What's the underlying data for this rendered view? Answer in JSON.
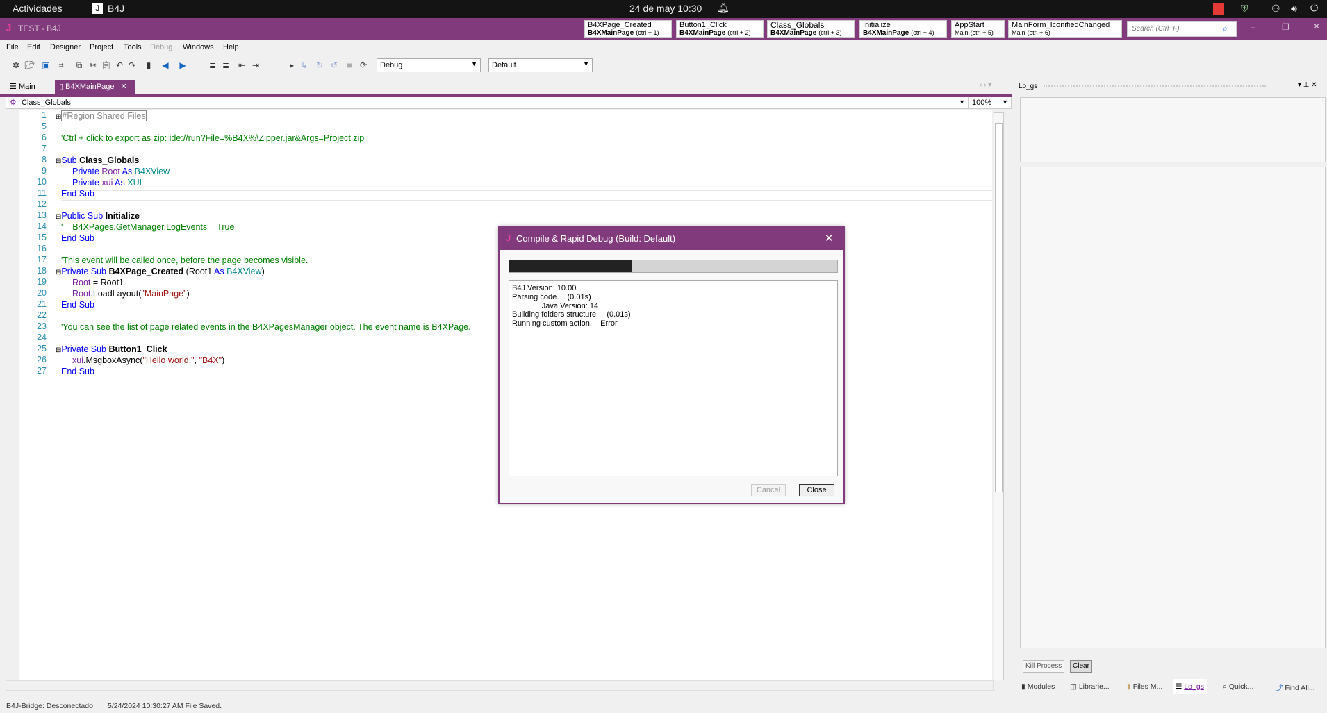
{
  "system_bar": {
    "activities": "Actividades",
    "app_name": "B4J",
    "clock": "24 de may  10:30"
  },
  "window": {
    "title": "TEST - B4J",
    "search_placeholder": "Search (Ctrl+F)",
    "nav_buttons": [
      {
        "name": "B4XPage_Created",
        "module": "B4XMainPage",
        "shortcut": "(ctrl + 1)"
      },
      {
        "name": "Button1_Click",
        "module": "B4XMainPage",
        "shortcut": "(ctrl + 2)"
      },
      {
        "name": "Class_Globals",
        "module": "B4XMainPage",
        "shortcut": "(ctrl + 3)"
      },
      {
        "name": "Initialize",
        "module": "B4XMainPage",
        "shortcut": "(ctrl + 4)"
      },
      {
        "name": "AppStart",
        "module": "Main",
        "shortcut": "(ctrl + 5)"
      },
      {
        "name": "MainForm_IconifiedChanged",
        "module": "Main",
        "shortcut": "(ctrl + 6)"
      }
    ]
  },
  "menu": [
    "File",
    "Edit",
    "Designer",
    "Project",
    "Tools",
    "Debug",
    "Windows",
    "Help"
  ],
  "toolbar": {
    "build_mode": "Debug",
    "build_config": "Default"
  },
  "tabs": [
    "Main",
    "B4XMainPage"
  ],
  "editor": {
    "sub_selector": "Class_Globals",
    "zoom": "100%"
  },
  "code_lines": [
    "1",
    "5",
    "6",
    "7",
    "8",
    "9",
    "10",
    "11",
    "12",
    "13",
    "14",
    "15",
    "16",
    "17",
    "18",
    "19",
    "20",
    "21",
    "22",
    "23",
    "24",
    "25",
    "26",
    "27"
  ],
  "code": {
    "region": "#Region Shared Files",
    "l6a": "'Ctrl + click to export as zip: ",
    "l6b": "ide://run?File=%B4X%\\Zipper.jar&Args=Project.zip",
    "sub": "Sub",
    "class_globals": "Class_Globals",
    "private": "Private",
    "root": "Root",
    "as": "As",
    "b4xview": "B4XView",
    "xui": "xui",
    "xui_t": "XUI",
    "end_sub": "End Sub",
    "public_sub": "Public Sub",
    "initialize": "Initialize",
    "l14": "'    B4XPages.GetManager.LogEvents = True",
    "l17": "'This event will be called once, before the page becomes visible.",
    "private_sub": "Private Sub",
    "b4xpage_created": "B4XPage_Created",
    "root1_open": " (Root1 ",
    "close_paren": ")",
    "l19b": " = Root1",
    "l20b": ".LoadLayout(",
    "mainpage": "\"MainPage\"",
    "l23": "'You can see the list of page related events in the B4XPagesManager object. The event name is B4XPage.",
    "button1_click": "Button1_Click",
    "l26a": "xui",
    "l26b": ".MsgboxAsync(",
    "hello": "\"Hello world!\"",
    "comma": ", ",
    "b4x": "\"B4X\""
  },
  "right_panel": {
    "title": "Lo_gs",
    "kill_process": "Kill Process",
    "clear": "Clear",
    "bottom_tabs": [
      "Modules",
      "Librarie...",
      "Files M...",
      "Lo_gs",
      "Quick...",
      "Find All..."
    ]
  },
  "status": {
    "bridge": "B4J-Bridge: Desconectado",
    "message": "5/24/2024 10:30:27 AM  File Saved."
  },
  "dialog": {
    "title": "Compile & Rapid Debug (Build: Default)",
    "progress_percent": 37.5,
    "log": "B4J Version: 10.00\nParsing code.    (0.01s)\n              Java Version: 14\nBuilding folders structure.    (0.01s)\nRunning custom action.    Error",
    "cancel": "Cancel",
    "close": "Close"
  },
  "colors": {
    "accent": "#813b7c",
    "keyword": "#0000ff",
    "comment": "#008000",
    "string": "#a31515",
    "type": "#008b8b"
  }
}
